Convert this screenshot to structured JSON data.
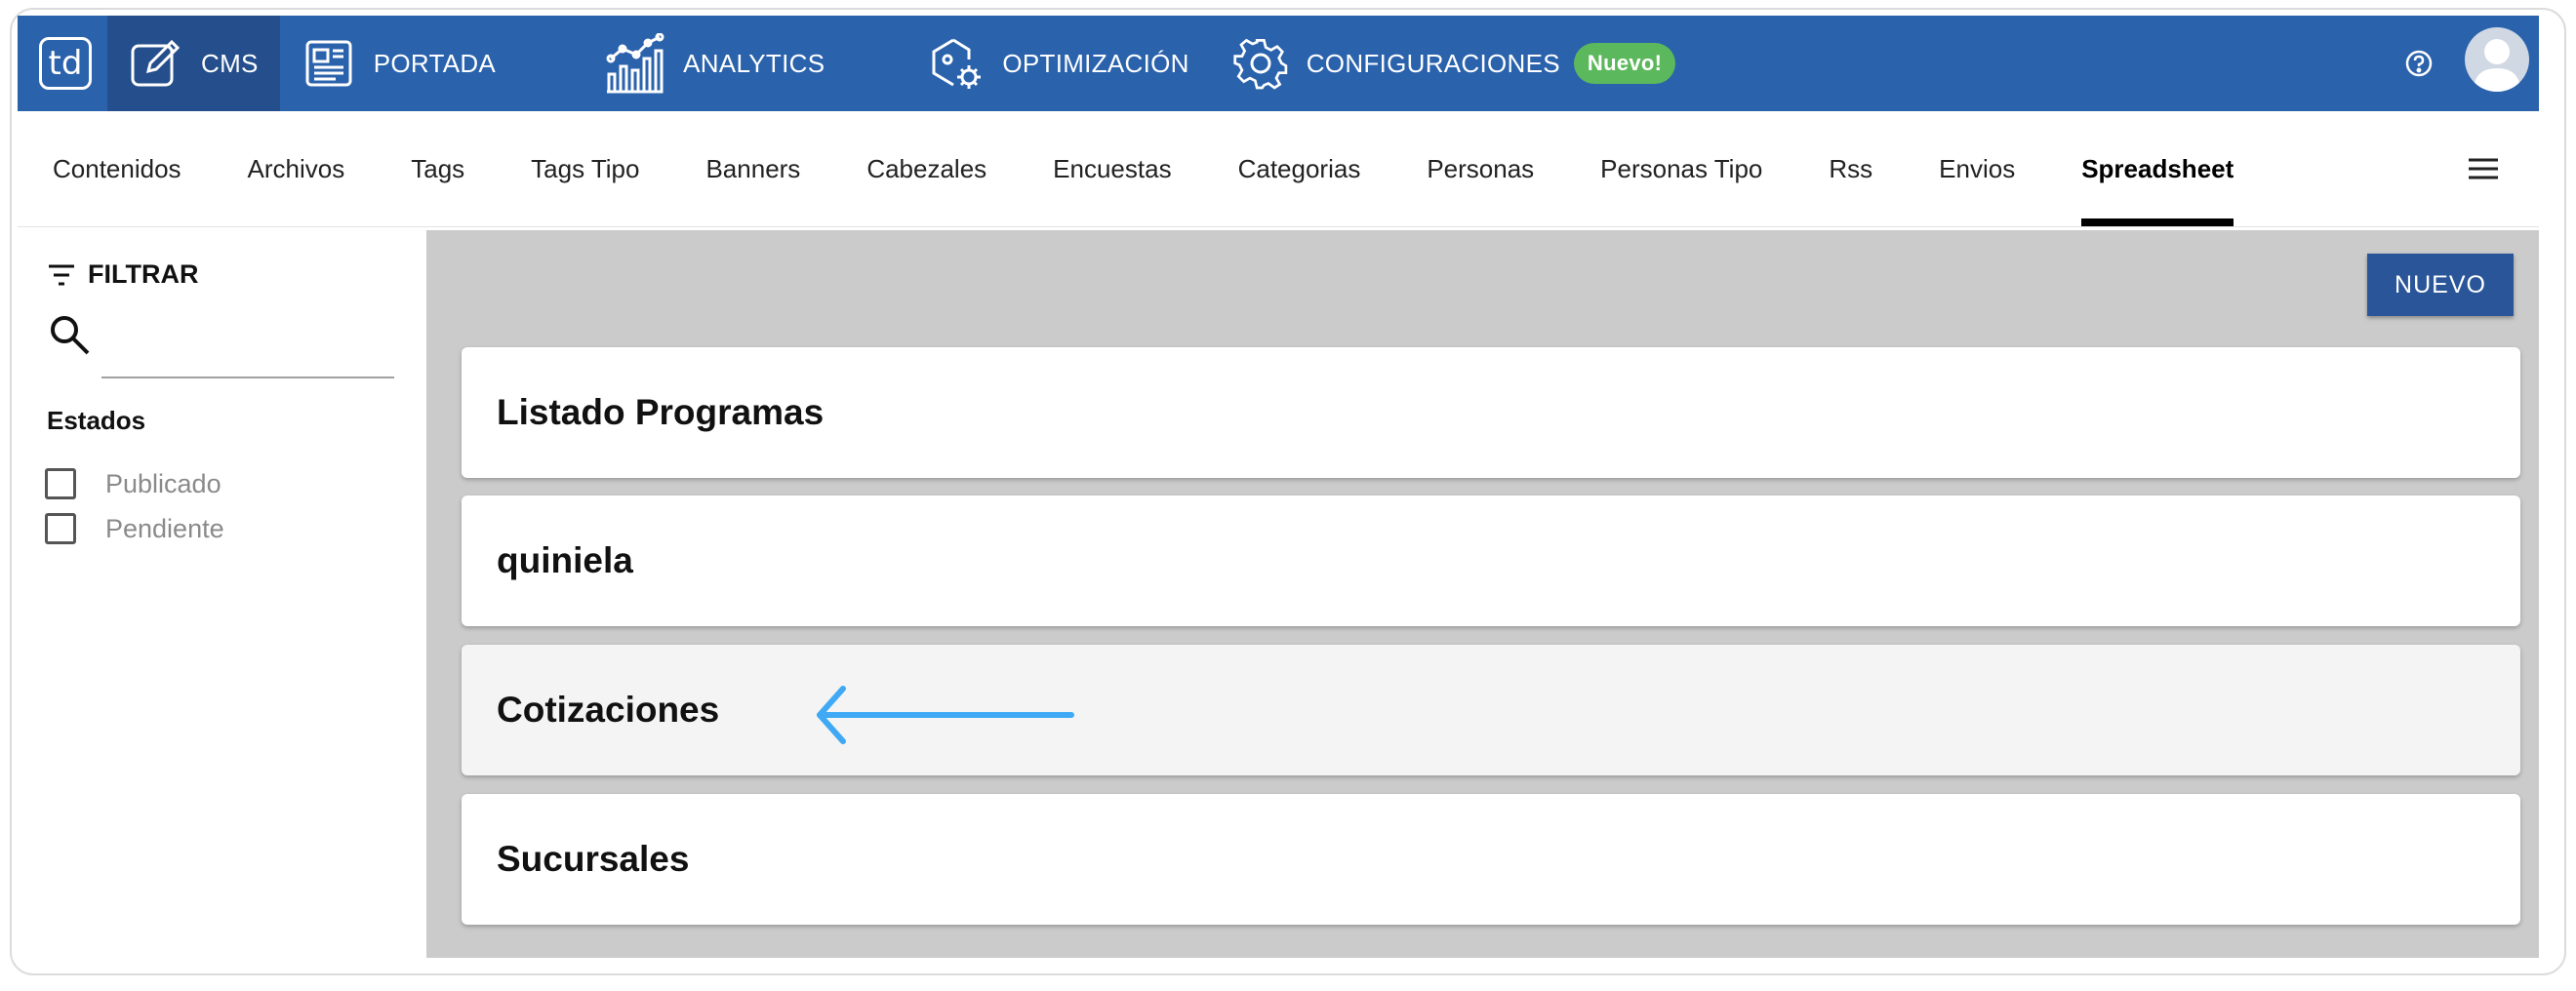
{
  "topnav": {
    "logo": "td",
    "items": [
      {
        "label": "CMS",
        "icon": "edit-icon"
      },
      {
        "label": "PORTADA",
        "icon": "newspaper-icon"
      },
      {
        "label": "ANALYTICS",
        "icon": "analytics-chart-icon"
      },
      {
        "label": "OPTIMIZACIÓN",
        "icon": "optimization-gear-icon"
      },
      {
        "label": "CONFIGURACIONES",
        "icon": "settings-gear-icon"
      }
    ],
    "badge": "Nuevo!",
    "colors": {
      "bar": "#2a62ac",
      "active": "#254f8c",
      "badge": "#5cb85c"
    }
  },
  "subnav": {
    "tabs": [
      "Contenidos",
      "Archivos",
      "Tags",
      "Tags Tipo",
      "Banners",
      "Cabezales",
      "Encuestas",
      "Categorias",
      "Personas",
      "Personas Tipo",
      "Rss",
      "Envios",
      "Spreadsheet"
    ],
    "active": "Spreadsheet"
  },
  "sidebar": {
    "filter_label": "FILTRAR",
    "search_value": "",
    "states_title": "Estados",
    "states": [
      {
        "label": "Publicado",
        "checked": false
      },
      {
        "label": "Pendiente",
        "checked": false
      }
    ]
  },
  "main": {
    "new_button": "NUEVO",
    "cards": [
      "Listado Programas",
      "quiniela",
      "Cotizaciones",
      "Sucursales"
    ],
    "annotation_arrow_color": "#3fa9f5"
  }
}
